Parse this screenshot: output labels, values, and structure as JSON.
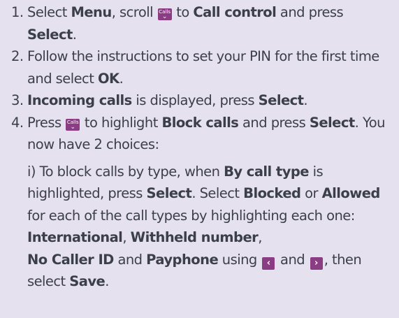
{
  "steps": [
    {
      "num": "1.",
      "parts": {
        "p1": "Select ",
        "b1": "Menu",
        "p2": ", scroll ",
        "p3": " to ",
        "b2": "Call control",
        "p4": " and press ",
        "b3": "Select",
        "p5": "."
      }
    },
    {
      "num": "2.",
      "parts": {
        "p1": "Follow the instructions to set your PIN for the first time and select ",
        "b1": "OK",
        "p2": "."
      }
    },
    {
      "num": "3.",
      "parts": {
        "b1": "Incoming calls",
        "p1": " is displayed, press ",
        "b2": "Select",
        "p2": "."
      }
    },
    {
      "num": "4.",
      "parts": {
        "p1": "Press ",
        "p2": " to highlight ",
        "b1": "Block calls",
        "p3": " and press ",
        "b2": "Select",
        "p4": ". You now have 2 choices:"
      },
      "sub": {
        "p1": "i) To block calls by type, when ",
        "b1": "By call type",
        "p2": " is highlighted, press ",
        "b2": "Select",
        "p3": ". Select ",
        "b3": "Blocked",
        "p4": " or ",
        "b4": "Allowed",
        "p5": " for each of the call types by highlighting each one: ",
        "b5": "International",
        "p6": ", ",
        "b6": "Withheld number",
        "p7": ", ",
        "b7": "No Caller ID",
        "p8": " and ",
        "b8": "Payphone",
        "p9": " using ",
        "p10": " and ",
        "p11": ", then select ",
        "b9": "Save",
        "p12": "."
      }
    }
  ],
  "keys": {
    "calls_label": "Calls",
    "calls_icon": "calls-scroll-down-key-icon",
    "left_icon": "left-arrow-key-icon",
    "right_icon": "right-arrow-key-icon"
  }
}
